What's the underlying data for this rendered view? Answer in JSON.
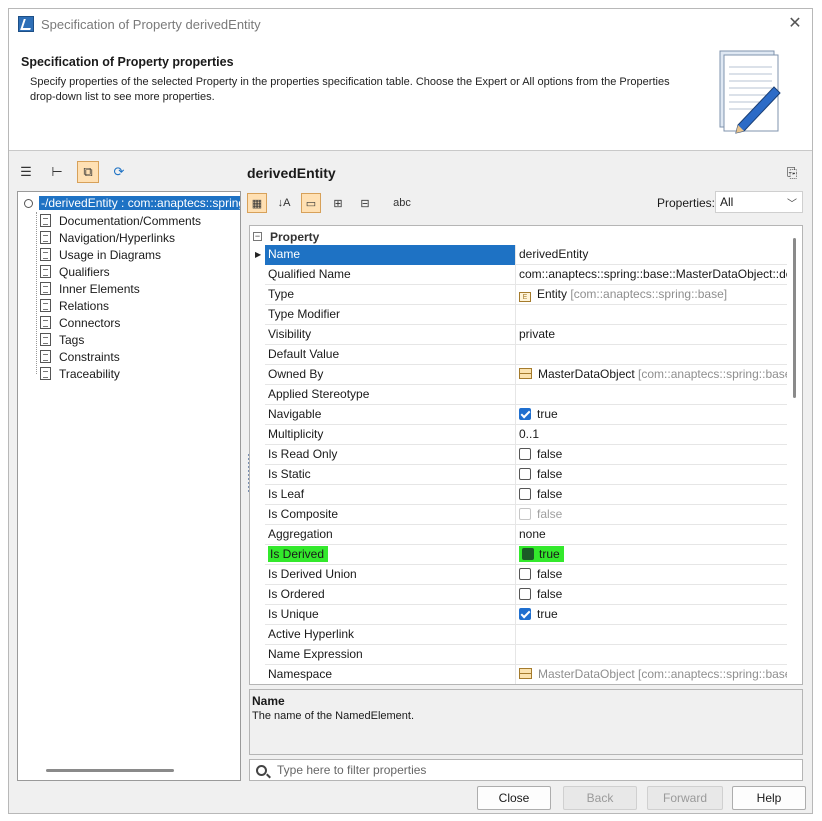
{
  "window": {
    "title": "Specification of Property derivedEntity"
  },
  "header": {
    "title": "Specification of Property properties",
    "description": "Specify properties of the selected Property in the properties specification table. Choose the Expert or All options from the Properties drop-down list to see more properties."
  },
  "tree": {
    "root": "-/derivedEntity : com::anaptecs::spring::base::Entity",
    "items": [
      "Documentation/Comments",
      "Navigation/Hyperlinks",
      "Usage in Diagrams",
      "Qualifiers",
      "Inner Elements",
      "Relations",
      "Connectors",
      "Tags",
      "Constraints",
      "Traceability"
    ]
  },
  "spec": {
    "element_name": "derivedEntity",
    "properties_label": "Properties:",
    "properties_value": "All",
    "group": "Property",
    "rows": [
      {
        "name": "Name",
        "value": "derivedEntity"
      },
      {
        "name": "Qualified Name",
        "value": "com::anaptecs::spring::base::MasterDataObject::derivedEntity"
      },
      {
        "name": "Type",
        "value": "Entity",
        "suffix": "[com::anaptecs::spring::base]"
      },
      {
        "name": "Type Modifier",
        "value": ""
      },
      {
        "name": "Visibility",
        "value": "private"
      },
      {
        "name": "Default Value",
        "value": ""
      },
      {
        "name": "Owned By",
        "value": "MasterDataObject",
        "suffix": "[com::anaptecs::spring::base]"
      },
      {
        "name": "Applied Stereotype",
        "value": ""
      },
      {
        "name": "Navigable",
        "value": "true"
      },
      {
        "name": "Multiplicity",
        "value": "0..1"
      },
      {
        "name": "Is Read Only",
        "value": "false"
      },
      {
        "name": "Is Static",
        "value": "false"
      },
      {
        "name": "Is Leaf",
        "value": "false"
      },
      {
        "name": "Is Composite",
        "value": "false"
      },
      {
        "name": "Aggregation",
        "value": "none"
      },
      {
        "name": "Is Derived",
        "value": "true"
      },
      {
        "name": "Is Derived Union",
        "value": "false"
      },
      {
        "name": "Is Ordered",
        "value": "false"
      },
      {
        "name": "Is Unique",
        "value": "true"
      },
      {
        "name": "Active Hyperlink",
        "value": ""
      },
      {
        "name": "Name Expression",
        "value": ""
      },
      {
        "name": "Namespace",
        "value": "MasterDataObject",
        "suffix": "[com::anaptecs::spring::base]"
      }
    ],
    "description_title": "Name",
    "description_text": "The name of the NamedElement.",
    "filter_placeholder": "Type here to filter properties"
  },
  "buttons": {
    "close": "Close",
    "back": "Back",
    "forward": "Forward",
    "help": "Help"
  },
  "colors": {
    "selection": "#1e72c4",
    "highlight": "#33e92c",
    "checkbox": "#1f6fcf"
  }
}
